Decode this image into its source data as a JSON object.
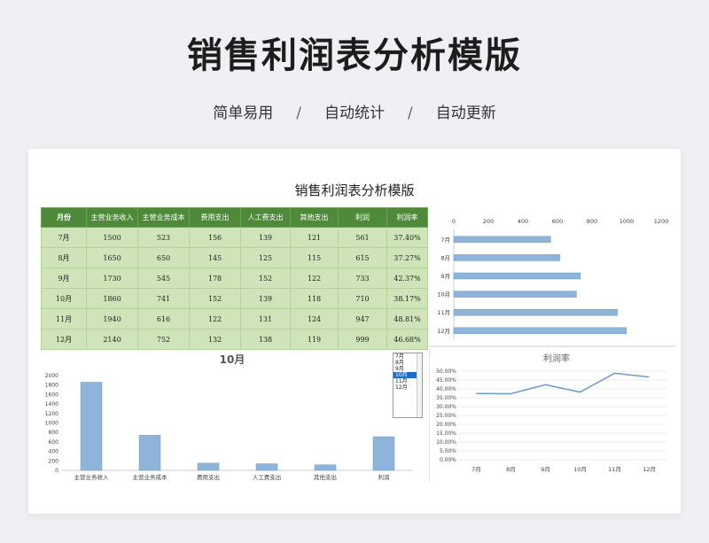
{
  "header": {
    "title": "销售利润表分析模版",
    "tags": [
      "简单易用",
      "自动统计",
      "自动更新"
    ],
    "separator": "/"
  },
  "sheet": {
    "title": "销售利润表分析模版",
    "table": {
      "columns": [
        "月份",
        "主营业务收入",
        "主营业务成本",
        "费用支出",
        "人工费支出",
        "其他支出",
        "利润",
        "利润率"
      ],
      "rows": [
        [
          "7月",
          "1500",
          "523",
          "156",
          "139",
          "121",
          "561",
          "37.40%"
        ],
        [
          "8月",
          "1650",
          "650",
          "145",
          "125",
          "115",
          "615",
          "37.27%"
        ],
        [
          "9月",
          "1730",
          "545",
          "178",
          "152",
          "122",
          "733",
          "42.37%"
        ],
        [
          "10月",
          "1860",
          "741",
          "152",
          "139",
          "118",
          "710",
          "38.17%"
        ],
        [
          "11月",
          "1940",
          "616",
          "122",
          "131",
          "124",
          "947",
          "48.81%"
        ],
        [
          "12月",
          "2140",
          "752",
          "132",
          "138",
          "119",
          "999",
          "46.68%"
        ]
      ]
    },
    "month_selector": {
      "options": [
        "7月",
        "8月",
        "9月",
        "10月",
        "11月",
        "12月"
      ],
      "selected": "10月"
    }
  },
  "chart_data": [
    {
      "type": "bar",
      "orientation": "horizontal",
      "categories": [
        "7月",
        "8月",
        "9月",
        "10月",
        "11月",
        "12月"
      ],
      "values": [
        561,
        615,
        733,
        710,
        947,
        999
      ],
      "xlim": [
        0,
        1200
      ],
      "xticks": [
        0,
        200,
        400,
        600,
        800,
        1000,
        1200
      ],
      "color": "#8fb4d9"
    },
    {
      "type": "bar",
      "title": "10月",
      "categories": [
        "主营业务收入",
        "主营业务成本",
        "费用支出",
        "人工费支出",
        "其他支出",
        "利润"
      ],
      "values": [
        1860,
        741,
        152,
        139,
        118,
        710
      ],
      "ylim": [
        0,
        2000
      ],
      "yticks": [
        0,
        200,
        400,
        600,
        800,
        1000,
        1200,
        1400,
        1600,
        1800,
        2000
      ],
      "color": "#8fb4d9"
    },
    {
      "type": "line",
      "title": "利润率",
      "categories": [
        "7月",
        "8月",
        "9月",
        "10月",
        "11月",
        "12月"
      ],
      "values": [
        37.4,
        37.27,
        42.37,
        38.17,
        48.81,
        46.68
      ],
      "ylim": [
        0,
        50
      ],
      "yticks": [
        "0.00%",
        "5.00%",
        "10.00%",
        "15.00%",
        "20.00%",
        "25.00%",
        "30.00%",
        "35.00%",
        "40.00%",
        "45.00%",
        "50.00%"
      ],
      "color": "#6a9ac9"
    }
  ]
}
